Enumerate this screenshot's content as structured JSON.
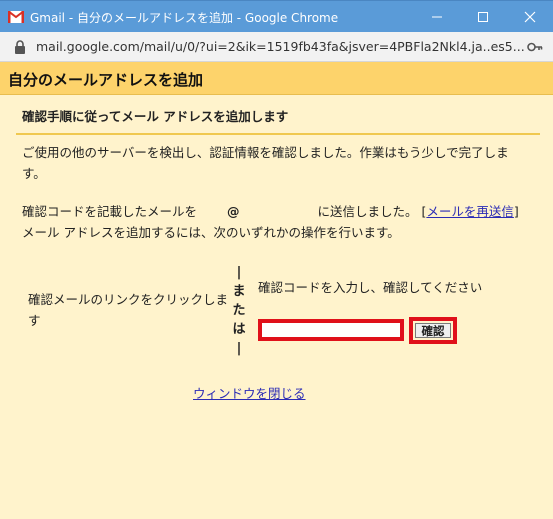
{
  "window": {
    "title": "Gmail - 自分のメールアドレスを追加 - Google Chrome"
  },
  "address_bar": {
    "url": "mail.google.com/mail/u/0/?ui=2&ik=1519fb43fa&jsver=4PBFla2Nkl4.ja..es5..."
  },
  "page": {
    "heading": "自分のメールアドレスを追加",
    "subtitle": "確認手順に従ってメール アドレスを追加します",
    "intro": "ご使用の他のサーバーを検出し、認証情報を確認しました。作業はもう少しで完了します。",
    "code_sent_prefix": "確認コードを記載したメールを",
    "email_at": "@",
    "code_sent_suffix": "に送信しました。",
    "resend_link": "メールを再送信",
    "choose_action": "メール アドレスを追加するには、次のいずれかの操作を行います。",
    "option_link": "確認メールのリンクをクリックします",
    "or_label_lines": [
      "|",
      "ま",
      "た",
      "は",
      "|"
    ],
    "option_code": "確認コードを入力し、確認してください",
    "code_input_value": "",
    "confirm_button": "確認",
    "close_window": "ウィンドウを閉じる"
  },
  "colors": {
    "titlebar": "#5a9bd8",
    "header": "#fdd36b",
    "background": "#fff3cc",
    "highlight": "#e0101a",
    "link": "#2b2bb5"
  },
  "icons": {
    "app": "gmail-icon",
    "lock": "lock-icon",
    "key": "key-icon"
  }
}
